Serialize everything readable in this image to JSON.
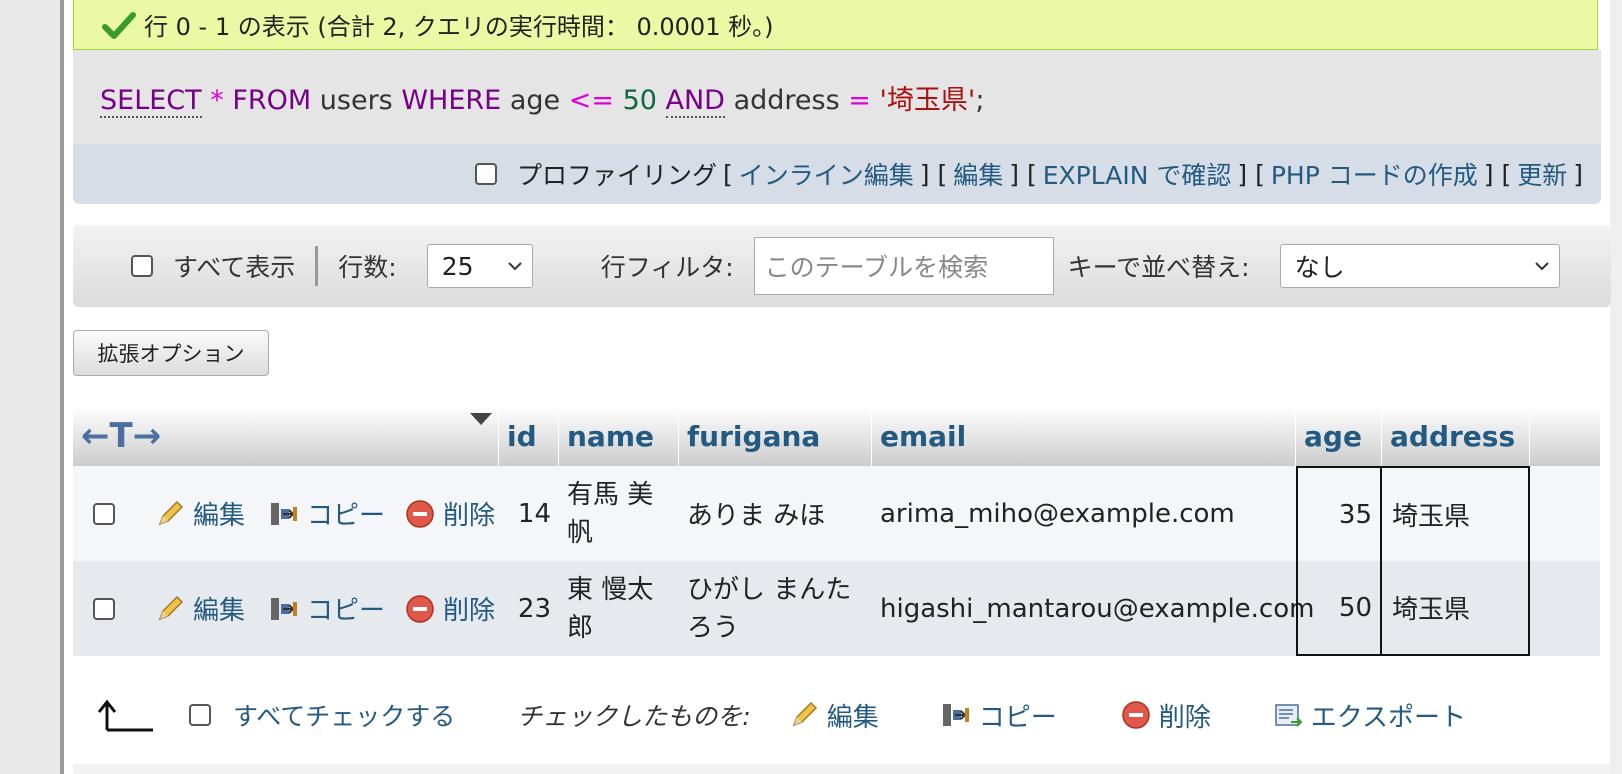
{
  "message": {
    "success_text": "行 0 - 1 の表示 (合計 2, クエリの実行時間： 0.0001 秒。)",
    "check_icon": "check-icon"
  },
  "sql": {
    "select": "SELECT",
    "star": "*",
    "from": "FROM",
    "table": "users",
    "where": "WHERE",
    "col1": "age",
    "op1": "<=",
    "val1": "50",
    "and": "AND",
    "col2": "address",
    "op2": "=",
    "val2": "'埼玉県'",
    "end": ";"
  },
  "query_links": {
    "profiling_label": "プロファイリング",
    "inline_edit": "インライン編集",
    "edit": "編集",
    "explain": "EXPLAIN で確認",
    "php_code": "PHP コードの作成",
    "refresh": "更新"
  },
  "navigation": {
    "show_all_label": "すべて表示",
    "rows_label": "行数:",
    "rows_value": "25",
    "filter_label": "行フィルタ:",
    "filter_placeholder": "このテーブルを検索",
    "sort_label": "キーで並べ替え:",
    "sort_value": "なし"
  },
  "extended_options_label": "拡張オプション",
  "table": {
    "arrows_label": "←T→",
    "columns": [
      "id",
      "name",
      "furigana",
      "email",
      "age",
      "address"
    ],
    "row_actions": {
      "edit": "編集",
      "copy": "コピー",
      "delete": "削除"
    },
    "rows": [
      {
        "id": "14",
        "name_line1": "有馬 美",
        "name_line2": "帆",
        "furigana_line1": "ありま みほ",
        "furigana_line2": "",
        "email": "arima_miho@example.com",
        "age": "35",
        "address": "埼玉県"
      },
      {
        "id": "23",
        "name_line1": "東 慢太",
        "name_line2": "郎",
        "furigana_line1": "ひがし まんた",
        "furigana_line2": "ろう",
        "email": "higashi_mantarou@example.com",
        "age": "50",
        "address": "埼玉県"
      }
    ],
    "colors": {
      "row_odd": "#f4f6f9",
      "row_even": "#e6e9ee",
      "link": "#235a81"
    }
  },
  "footer": {
    "check_all_label": "すべてチェックする",
    "with_selected_label": "チェックしたものを:",
    "edit": "編集",
    "copy": "コピー",
    "delete": "削除",
    "export": "エクスポート"
  }
}
